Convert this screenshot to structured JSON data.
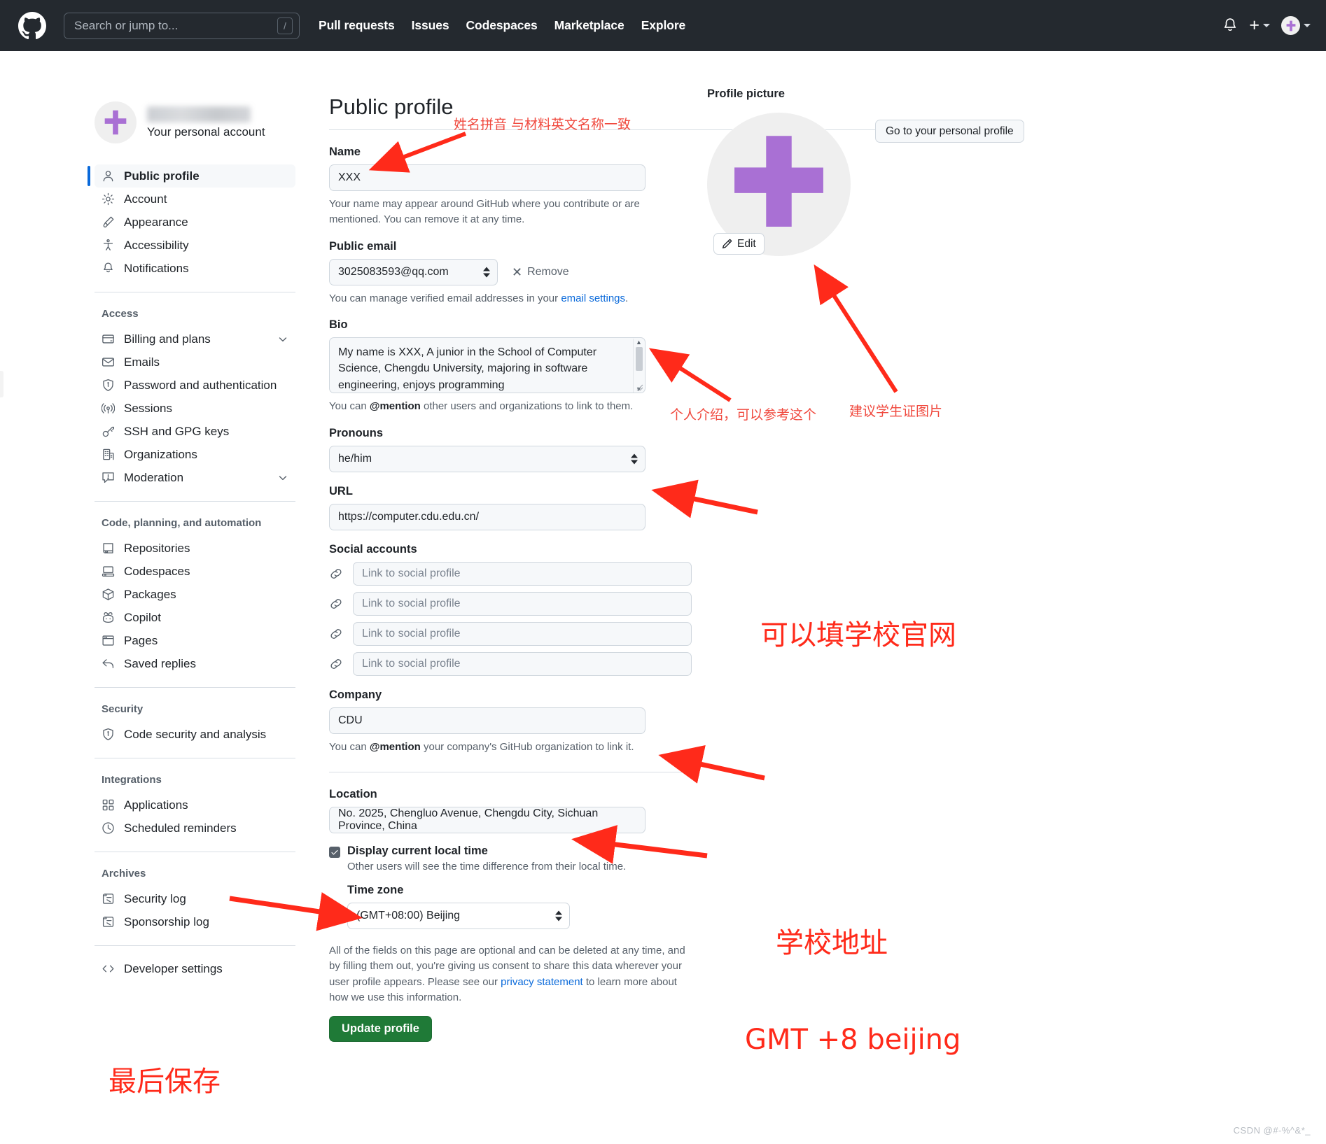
{
  "header": {
    "logo_icon": "github-mark-icon",
    "search": {
      "placeholder": "Search or jump to...",
      "shortcut": "/"
    },
    "nav": [
      "Pull requests",
      "Issues",
      "Codespaces",
      "Marketplace",
      "Explore"
    ],
    "bell_icon": "notification-bell-icon",
    "plus_icon": "plus-icon",
    "avatar_icon": "user-avatar-icon"
  },
  "sidebar": {
    "account_subtitle": "Your personal account",
    "groups": [
      {
        "label": "",
        "items": [
          {
            "label": "Public profile",
            "icon": "person-icon",
            "active": true
          },
          {
            "label": "Account",
            "icon": "gear-icon"
          },
          {
            "label": "Appearance",
            "icon": "paintbrush-icon"
          },
          {
            "label": "Accessibility",
            "icon": "accessibility-icon"
          },
          {
            "label": "Notifications",
            "icon": "bell-icon"
          }
        ]
      },
      {
        "label": "Access",
        "items": [
          {
            "label": "Billing and plans",
            "icon": "credit-card-icon",
            "chevron": true
          },
          {
            "label": "Emails",
            "icon": "mail-icon"
          },
          {
            "label": "Password and authentication",
            "icon": "shield-lock-icon"
          },
          {
            "label": "Sessions",
            "icon": "broadcast-icon"
          },
          {
            "label": "SSH and GPG keys",
            "icon": "key-icon"
          },
          {
            "label": "Organizations",
            "icon": "organization-icon"
          },
          {
            "label": "Moderation",
            "icon": "report-icon",
            "chevron": true
          }
        ]
      },
      {
        "label": "Code, planning, and automation",
        "items": [
          {
            "label": "Repositories",
            "icon": "repo-icon"
          },
          {
            "label": "Codespaces",
            "icon": "codespaces-icon"
          },
          {
            "label": "Packages",
            "icon": "package-icon"
          },
          {
            "label": "Copilot",
            "icon": "copilot-icon"
          },
          {
            "label": "Pages",
            "icon": "browser-icon"
          },
          {
            "label": "Saved replies",
            "icon": "reply-icon"
          }
        ]
      },
      {
        "label": "Security",
        "items": [
          {
            "label": "Code security and analysis",
            "icon": "shield-check-icon"
          }
        ]
      },
      {
        "label": "Integrations",
        "items": [
          {
            "label": "Applications",
            "icon": "apps-grid-icon"
          },
          {
            "label": "Scheduled reminders",
            "icon": "clock-icon"
          }
        ]
      },
      {
        "label": "Archives",
        "items": [
          {
            "label": "Security log",
            "icon": "log-icon"
          },
          {
            "label": "Sponsorship log",
            "icon": "log-icon"
          }
        ]
      },
      {
        "label": "",
        "items": [
          {
            "label": "Developer settings",
            "icon": "code-icon"
          }
        ]
      }
    ]
  },
  "main": {
    "title": "Public profile",
    "goto_profile_button": "Go to your personal profile",
    "name": {
      "label": "Name",
      "value": "XXX",
      "hint": "Your name may appear around GitHub where you contribute or are mentioned. You can remove it at any time."
    },
    "public_email": {
      "label": "Public email",
      "value": "3025083593@qq.com",
      "remove_label": "Remove",
      "hint_prefix": "You can manage verified email addresses in your ",
      "hint_link": "email settings",
      "hint_suffix": "."
    },
    "bio": {
      "label": "Bio",
      "value": "My name is XXX, A junior in the School of Computer Science, Chengdu University, majoring in software engineering, enjoys programming",
      "hint_prefix": "You can ",
      "hint_mention": "@mention",
      "hint_suffix": " other users and organizations to link to them."
    },
    "pronouns": {
      "label": "Pronouns",
      "value": "he/him"
    },
    "url": {
      "label": "URL",
      "value": "https://computer.cdu.edu.cn/"
    },
    "social": {
      "label": "Social accounts",
      "placeholder": "Link to social profile",
      "count": 4,
      "icon": "link-icon"
    },
    "company": {
      "label": "Company",
      "value": "CDU",
      "hint_prefix": "You can ",
      "hint_mention": "@mention",
      "hint_suffix": " your company's GitHub organization to link it."
    },
    "location": {
      "label": "Location",
      "value": "No. 2025, Chengluo Avenue, Chengdu City, Sichuan Province, China"
    },
    "local_time": {
      "checkbox_label": "Display current local time",
      "checked": true,
      "sub": "Other users will see the time difference from their local time."
    },
    "timezone": {
      "label": "Time zone",
      "value": "(GMT+08:00) Beijing"
    },
    "legal": {
      "text_before_link": "All of the fields on this page are optional and can be deleted at any time, and by filling them out, you're giving us consent to share this data wherever your user profile appears. Please see our ",
      "link": "privacy statement",
      "text_after_link": " to learn more about how we use this information."
    },
    "update_button": "Update profile"
  },
  "profile_picture": {
    "label": "Profile picture",
    "edit_button": "Edit",
    "edit_icon": "pencil-icon",
    "avatar_color": "#a970d4"
  },
  "annotations": [
    {
      "id": "name-pinyin",
      "text": "姓名拼音 与材料英文名称一致",
      "size": "sm"
    },
    {
      "id": "bio-note",
      "text": "个人介绍，可以参考这个",
      "size": "sm"
    },
    {
      "id": "avatar-note",
      "text": "建议学生证图片",
      "size": "sm"
    },
    {
      "id": "url-note",
      "text": "可以填学校官网",
      "size": "lg"
    },
    {
      "id": "location-note",
      "text": "学校地址",
      "size": "lg"
    },
    {
      "id": "timezone-note",
      "text": "GMT +8 beijing",
      "size": "lg"
    },
    {
      "id": "save-note",
      "text": "最后保存",
      "size": "lg"
    }
  ],
  "watermark": "CSDN @#-%^&*_",
  "colors": {
    "header_bg": "#24292f",
    "accent_blue": "#0969da",
    "button_green": "#1f7a37",
    "annotation_red": "#ff2a1a",
    "avatar_purple": "#a970d4"
  }
}
